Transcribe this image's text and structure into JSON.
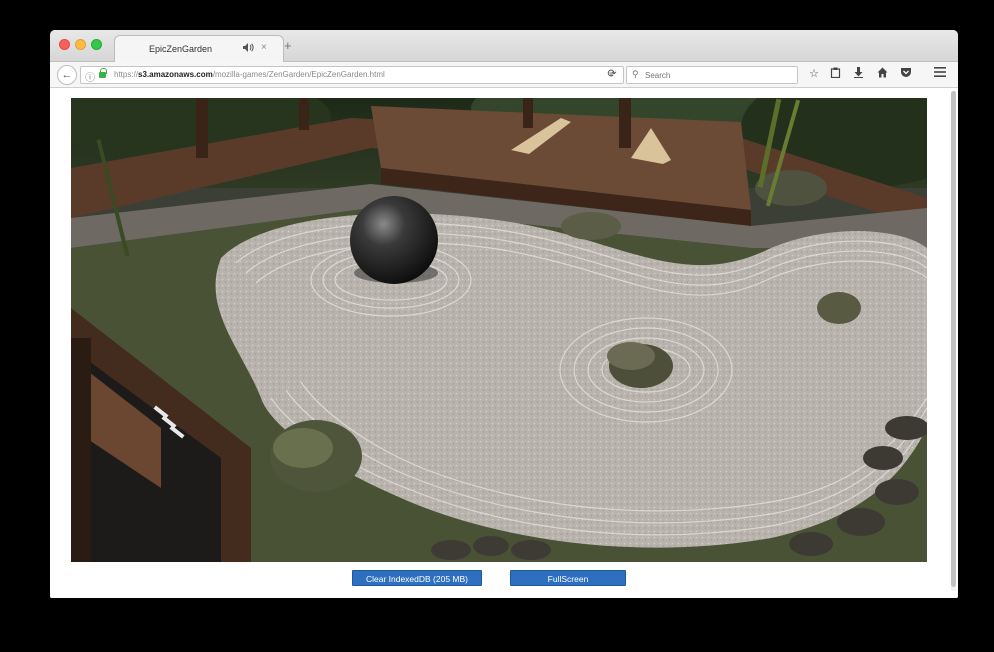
{
  "browser": {
    "tab": {
      "title": "EpicZenGarden",
      "audio_icon": "speaker-icon",
      "close_glyph": "×"
    },
    "new_tab_glyph": "+",
    "url": {
      "prefix": "https://",
      "host": "s3.amazonaws.com",
      "path": "/mozilla-games/ZenGarden/EpicZenGarden.html"
    },
    "search": {
      "placeholder": "Search"
    },
    "toolbar_icons": [
      "star-icon",
      "clipboard-icon",
      "download-icon",
      "home-icon",
      "pocket-icon",
      "menu-icon"
    ]
  },
  "page": {
    "buttons": {
      "clear_indexeddb": "Clear IndexedDB (205 MB)",
      "fullscreen": "FullScreen"
    }
  },
  "colors": {
    "window_bg": "#ffffff",
    "button_blue": "#2f6fbf",
    "desktop_bg": "#000000"
  }
}
